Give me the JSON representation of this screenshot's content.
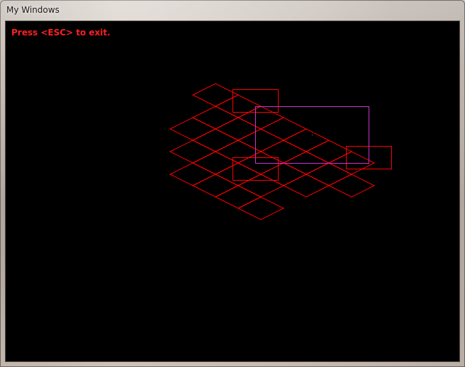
{
  "window": {
    "title": "My Windows"
  },
  "canvas": {
    "hint_text": "Press <ESC> to exit.",
    "hint_color": "#ff2020",
    "background_color": "#000000",
    "grid_color": "#ff0000",
    "selection_color": "#cc33cc"
  }
}
